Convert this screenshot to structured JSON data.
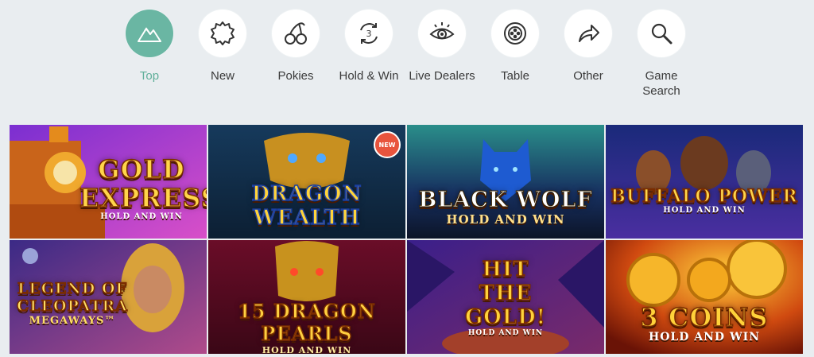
{
  "categories": [
    {
      "label": "Top",
      "icon": "mountain-icon",
      "active": true
    },
    {
      "label": "New",
      "icon": "badge-star-icon",
      "active": false
    },
    {
      "label": "Pokies",
      "icon": "cherries-icon",
      "active": false
    },
    {
      "label": "Hold & Win",
      "icon": "respin-three-icon",
      "active": false
    },
    {
      "label": "Live Dealers",
      "icon": "eye-icon",
      "active": false
    },
    {
      "label": "Table",
      "icon": "chip-icon",
      "active": false
    },
    {
      "label": "Other",
      "icon": "share-arrow-icon",
      "active": false
    },
    {
      "label": "Game Search",
      "icon": "search-icon",
      "active": false
    }
  ],
  "colors": {
    "active": "#6ab6a3",
    "page_bg": "#e9edf0"
  },
  "games": [
    {
      "title_main": "GOLD EXPRESS",
      "title_sub": "HOLD AND WIN",
      "badge": ""
    },
    {
      "title_main": "DRAGON WEALTH",
      "title_sub": "",
      "badge": "NEW"
    },
    {
      "title_main": "BLACK WOLF",
      "title_sub": "HOLD AND WIN",
      "badge": ""
    },
    {
      "title_main": "BUFFALO POWER",
      "title_sub": "HOLD AND WIN",
      "badge": ""
    },
    {
      "title_main": "LEGEND OF CLEOPATRA",
      "title_sub": "MEGAWAYS™",
      "badge": ""
    },
    {
      "title_main": "15 DRAGON PEARLS",
      "title_sub": "HOLD AND WIN",
      "badge": ""
    },
    {
      "title_main": "HIT THE GOLD!",
      "title_sub": "HOLD AND WIN",
      "badge": ""
    },
    {
      "title_main": "3 COINS",
      "title_sub": "HOLD AND WIN",
      "badge": ""
    }
  ]
}
